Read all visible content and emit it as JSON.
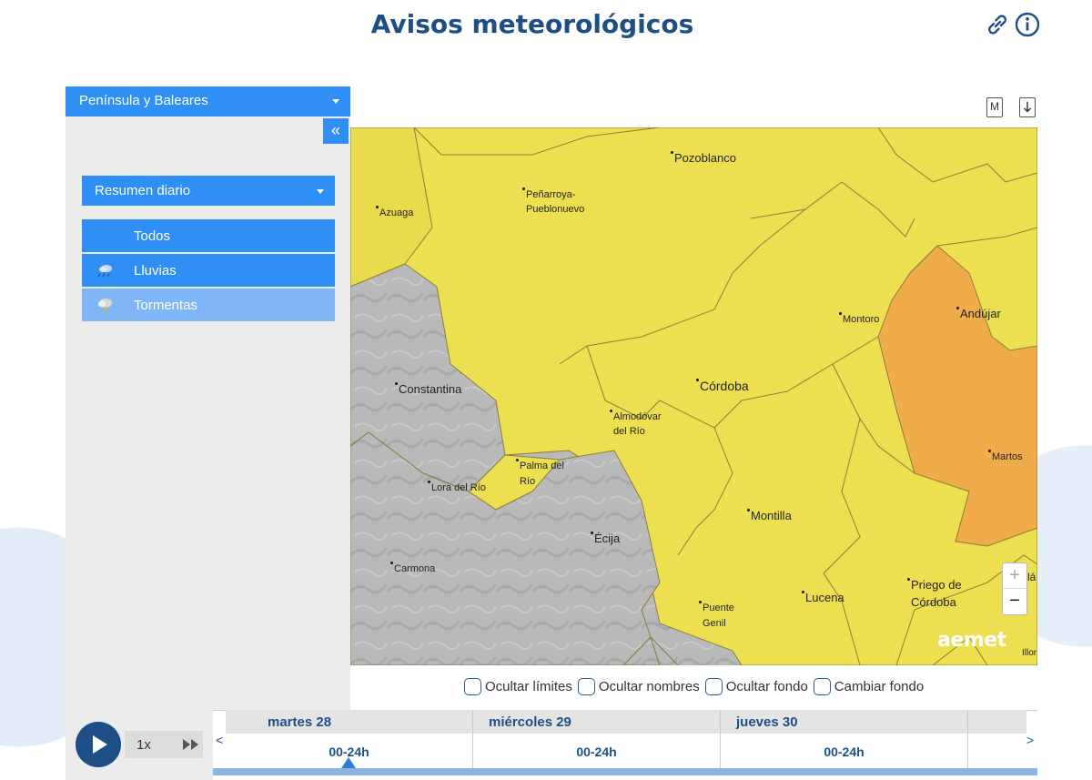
{
  "header": {
    "title": "Avisos meteorológicos",
    "icons": [
      "link-icon",
      "info-icon"
    ]
  },
  "sidebar": {
    "region": "Península y Baleares",
    "collapse_label": "«",
    "view_select": "Resumen diario",
    "phenomena": [
      {
        "label": "Todos",
        "icon": "none"
      },
      {
        "label": "Lluvias",
        "icon": "rain-icon"
      },
      {
        "label": "Tormentas",
        "icon": "storm-icon"
      }
    ]
  },
  "map": {
    "cities": [
      "Pozoblanco",
      "Peñarroya-",
      "Pueblonuevo",
      "Azuaga",
      "Andújar",
      "Montoro",
      "Constantina",
      "Córdoba",
      "Almodóvar",
      "del Río",
      "Martos",
      "Palma del",
      "Río",
      "Lora del Río",
      "Montilla",
      "Écija",
      "Carmona",
      "Priego de",
      "Córdoba",
      "Lucena",
      "Puente",
      "Genil",
      "Illor",
      "lá"
    ],
    "zoom_in": "+",
    "zoom_out": "−",
    "logo": "aemet",
    "legend_button": "M",
    "download_icon": "download-icon",
    "colors": {
      "yellow": "#ece050",
      "orange": "#f0ac4a",
      "gray": "#b7b7b7",
      "border": "#8a7d3c"
    }
  },
  "options": [
    "Ocultar límites",
    "Ocultar nombres",
    "Ocultar fondo",
    "Cambiar fondo"
  ],
  "timeline": {
    "speed": "1x",
    "days": [
      {
        "name": "martes 28",
        "slot": "00-24h"
      },
      {
        "name": "miércoles 29",
        "slot": "00-24h"
      },
      {
        "name": "jueves 30",
        "slot": "00-24h"
      }
    ],
    "prev": "<",
    "next": ">"
  }
}
